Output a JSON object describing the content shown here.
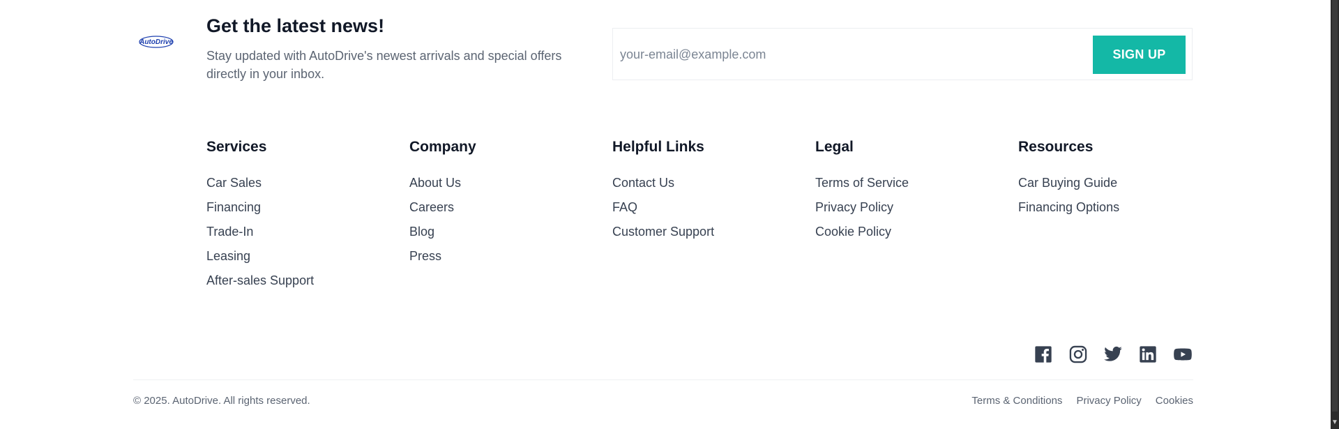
{
  "newsletter": {
    "logo_text": "AutoDrive",
    "title": "Get the latest news!",
    "description": "Stay updated with AutoDrive's newest arrivals and special offers directly in your inbox.",
    "email_placeholder": "your-email@example.com",
    "email_value": "",
    "signup_label": "SIGN UP",
    "accent_color": "#14b8a6"
  },
  "columns": [
    {
      "title": "Services",
      "links": [
        "Car Sales",
        "Financing",
        "Trade-In",
        "Leasing",
        "After-sales Support"
      ]
    },
    {
      "title": "Company",
      "links": [
        "About Us",
        "Careers",
        "Blog",
        "Press"
      ]
    },
    {
      "title": "Helpful Links",
      "links": [
        "Contact Us",
        "FAQ",
        "Customer Support"
      ]
    },
    {
      "title": "Legal",
      "links": [
        "Terms of Service",
        "Privacy Policy",
        "Cookie Policy"
      ]
    },
    {
      "title": "Resources",
      "links": [
        "Car Buying Guide",
        "Financing Options"
      ]
    }
  ],
  "social": [
    "facebook-icon",
    "instagram-icon",
    "twitter-icon",
    "linkedin-icon",
    "youtube-icon"
  ],
  "footer": {
    "copyright": "© 2025. AutoDrive. All rights reserved.",
    "links": [
      "Terms & Conditions",
      "Privacy Policy",
      "Cookies"
    ]
  }
}
